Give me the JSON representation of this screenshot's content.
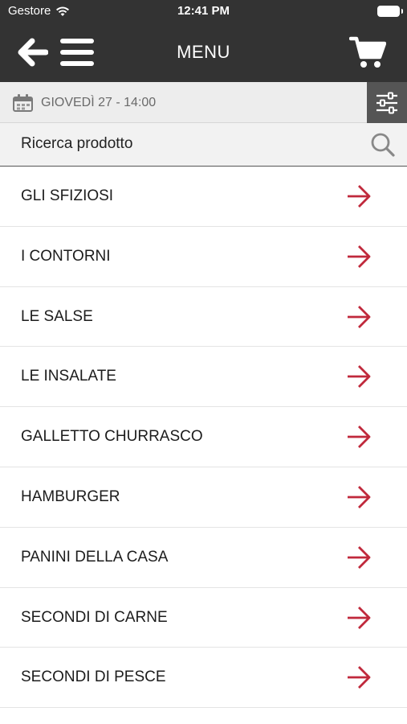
{
  "status_bar": {
    "carrier": "Gestore",
    "time": "12:41 PM"
  },
  "nav": {
    "title": "MENU",
    "icons": [
      "back-arrow-icon",
      "hamburger-menu-icon",
      "shopping-cart-icon"
    ]
  },
  "schedule": {
    "date_text": "GIOVEDÌ 27 - 14:00"
  },
  "search": {
    "placeholder": "Ricerca prodotto"
  },
  "categories": [
    {
      "label": "GLI SFIZIOSI"
    },
    {
      "label": "I CONTORNI"
    },
    {
      "label": "LE SALSE"
    },
    {
      "label": "LE INSALATE"
    },
    {
      "label": "GALLETTO CHURRASCO"
    },
    {
      "label": "HAMBURGER"
    },
    {
      "label": "PANINI DELLA CASA"
    },
    {
      "label": "SECONDI DI CARNE"
    },
    {
      "label": "SECONDI DI PESCE"
    }
  ],
  "colors": {
    "header_bg": "#333333",
    "accent_arrow": "#c0293c",
    "filter_bg": "#555555",
    "date_bar_bg": "#ededed"
  }
}
